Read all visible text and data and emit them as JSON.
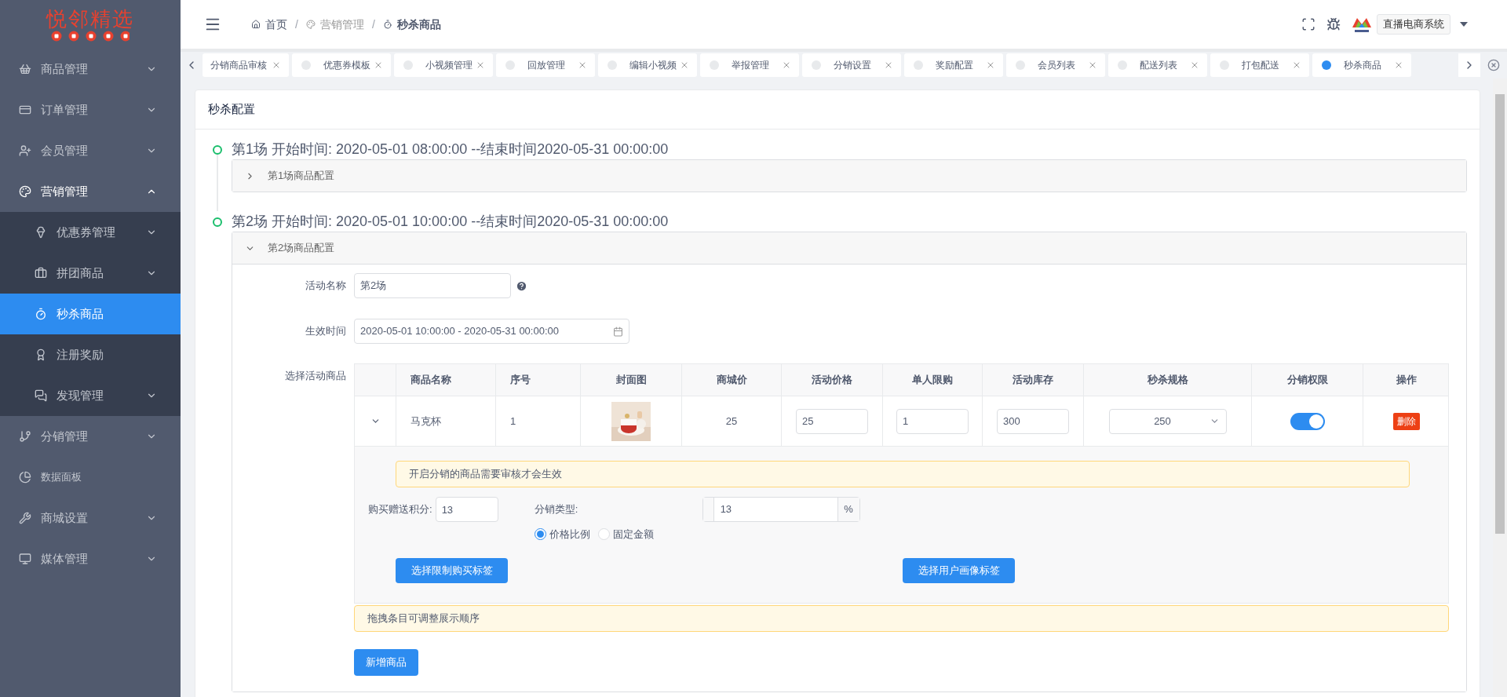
{
  "logo": {
    "title": "悦邻精选"
  },
  "sidebar": {
    "items": [
      {
        "label": "商品管理",
        "selected": false,
        "expanded": false
      },
      {
        "label": "订单管理",
        "selected": false,
        "expanded": false
      },
      {
        "label": "会员管理",
        "selected": false,
        "expanded": false
      },
      {
        "label": "营销管理",
        "selected": false,
        "expanded": true,
        "children": [
          {
            "label": "优惠券管理",
            "selected": false,
            "expanded": false
          },
          {
            "label": "拼团商品",
            "selected": false,
            "expanded": false
          },
          {
            "label": "秒杀商品",
            "selected": true
          },
          {
            "label": "注册奖励",
            "selected": false
          },
          {
            "label": "发现管理",
            "selected": false,
            "expanded": false
          }
        ]
      },
      {
        "label": "分销管理",
        "selected": false,
        "expanded": false
      },
      {
        "label": "数据面板",
        "selected": false,
        "small": true
      },
      {
        "label": "商城设置",
        "selected": false,
        "expanded": false
      },
      {
        "label": "媒体管理",
        "selected": false,
        "expanded": false
      }
    ]
  },
  "header": {
    "breadcrumb": [
      {
        "label": "首页",
        "current": false
      },
      {
        "label": "营销管理",
        "current": false
      },
      {
        "label": "秒杀商品",
        "current": true
      }
    ],
    "separator": "/",
    "system": "直播电商系统"
  },
  "tabs": [
    {
      "label": "分销商品审核",
      "selected": false,
      "clipped": true
    },
    {
      "label": "优惠券模板",
      "selected": false,
      "clipped": false
    },
    {
      "label": "小视频管理",
      "selected": false,
      "clipped": false
    },
    {
      "label": "回放管理",
      "selected": false,
      "clipped": false
    },
    {
      "label": "编辑小视频",
      "selected": false,
      "clipped": false
    },
    {
      "label": "举报管理",
      "selected": false,
      "clipped": false
    },
    {
      "label": "分销设置",
      "selected": false,
      "clipped": false
    },
    {
      "label": "奖励配置",
      "selected": false,
      "clipped": false
    },
    {
      "label": "会员列表",
      "selected": false,
      "clipped": false
    },
    {
      "label": "配送列表",
      "selected": false,
      "clipped": false
    },
    {
      "label": "打包配送",
      "selected": false,
      "clipped": false
    },
    {
      "label": "秒杀商品",
      "selected": true,
      "clipped": false
    }
  ],
  "card": {
    "title": "秒杀配置"
  },
  "sessions": [
    {
      "title": "第1场 开始时间: 2020-05-01 08:00:00 --结束时间2020-05-31 00:00:00",
      "panel_title": "第1场商品配置",
      "expanded": false
    },
    {
      "title": "第2场 开始时间: 2020-05-01 10:00:00 --结束时间2020-05-31 00:00:00",
      "panel_title": "第2场商品配置",
      "expanded": true
    }
  ],
  "form": {
    "activity_name": {
      "label": "活动名称",
      "value": "第2场"
    },
    "effective_time": {
      "label": "生效时间",
      "value": "2020-05-01 10:00:00 - 2020-05-31 00:00:00"
    },
    "products_label": "选择活动商品",
    "table": {
      "columns": [
        "商品名称",
        "序号",
        "封面图",
        "商城价",
        "活动价格",
        "单人限购",
        "活动库存",
        "秒杀规格",
        "分销权限",
        "操作"
      ],
      "rows": [
        {
          "expanded": true,
          "name": "马克杯",
          "seq": "1",
          "price": "25",
          "activity_price": "25",
          "limit": "1",
          "stock": "300",
          "spec": "250",
          "distribution_on": true,
          "action": "删除"
        }
      ]
    },
    "detail": {
      "notice": "开启分销的商品需要审核才会生效",
      "points": {
        "label": "购买赠送积分:",
        "value": "13"
      },
      "distribution_type": {
        "label": "分销类型:",
        "value": "13",
        "suffix": "%",
        "options": [
          {
            "label": "价格比例",
            "selected": true
          },
          {
            "label": "固定金额",
            "selected": false
          }
        ]
      },
      "buttons": [
        "选择限制购买标签",
        "选择用户画像标签"
      ]
    },
    "tip": "拖拽条目可调整展示顺序",
    "add_button": "新增商品"
  }
}
